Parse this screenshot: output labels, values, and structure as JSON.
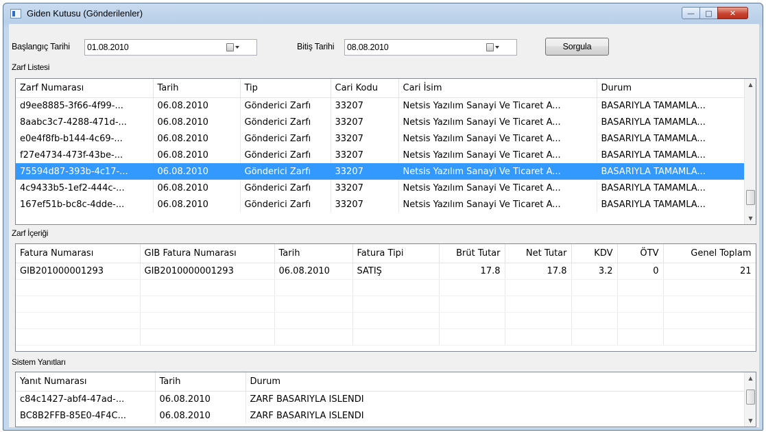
{
  "window": {
    "title": "Giden Kutusu (Gönderilenler)",
    "minimize_glyph": "—",
    "maximize_glyph": "□",
    "close_glyph": "✕"
  },
  "filters": {
    "start_label": "Başlangıç Tarihi",
    "start_value": "01.08.2010",
    "end_label": "Bitiş Tarihi",
    "end_value": "08.08.2010",
    "query_button": "Sorgula"
  },
  "envelopes": {
    "group_label": "Zarf Listesi",
    "columns": [
      "Zarf Numarası",
      "Tarih",
      "Tip",
      "Cari Kodu",
      "Cari İsim",
      "Durum"
    ],
    "rows": [
      [
        "d9ee8885-3f66-4f99-...",
        "06.08.2010",
        "Gönderici Zarfı",
        "33207",
        "Netsis Yazılım Sanayi Ve Ticaret A...",
        "BASARIYLA TAMAMLA..."
      ],
      [
        "8aabc3c7-4288-471d-...",
        "06.08.2010",
        "Gönderici Zarfı",
        "33207",
        "Netsis Yazılım Sanayi Ve Ticaret A...",
        "BASARIYLA TAMAMLA..."
      ],
      [
        "e0e4f8fb-b144-4c69-...",
        "06.08.2010",
        "Gönderici Zarfı",
        "33207",
        "Netsis Yazılım Sanayi Ve Ticaret A...",
        "BASARIYLA TAMAMLA..."
      ],
      [
        "f27e4734-473f-43be-...",
        "06.08.2010",
        "Gönderici Zarfı",
        "33207",
        "Netsis Yazılım Sanayi Ve Ticaret A...",
        "BASARIYLA TAMAMLA..."
      ],
      [
        "75594d87-393b-4c17-...",
        "06.08.2010",
        "Gönderici Zarfı",
        "33207",
        "Netsis Yazılım Sanayi Ve Ticaret A...",
        "BASARIYLA TAMAMLA..."
      ],
      [
        "4c9433b5-1ef2-444c-...",
        "06.08.2010",
        "Gönderici Zarfı",
        "33207",
        "Netsis Yazılım Sanayi Ve Ticaret A...",
        "BASARIYLA TAMAMLA..."
      ],
      [
        "167ef51b-bc8c-4dde-...",
        "06.08.2010",
        "Gönderici Zarfı",
        "33207",
        "Netsis Yazılım Sanayi Ve Ticaret A...",
        "BASARIYLA TAMAMLA..."
      ]
    ],
    "selected_row": 4,
    "accent_color": "#3399ff"
  },
  "contents": {
    "group_label": "Zarf İçeriği",
    "columns": [
      "Fatura Numarası",
      "GIB Fatura Numarası",
      "Tarih",
      "Fatura Tipi",
      "Brüt Tutar",
      "Net Tutar",
      "KDV",
      "ÖTV",
      "Genel Toplam"
    ],
    "rows": [
      [
        "GIB201000001293",
        "GIB2010000001293",
        "06.08.2010",
        "SATIŞ",
        "17.8",
        "17.8",
        "3.2",
        "0",
        "21"
      ]
    ]
  },
  "responses": {
    "group_label": "Sistem Yanıtları",
    "columns": [
      "Yanıt Numarası",
      "Tarih",
      "Durum"
    ],
    "rows": [
      [
        "c84c1427-abf4-47ad-...",
        "06.08.2010",
        "ZARF BASARIYLA ISLENDI"
      ],
      [
        "BC8B2FFB-85E0-4F4C...",
        "06.08.2010",
        "ZARF BASARIYLA ISLENDI"
      ]
    ]
  },
  "icons": {
    "scroll_up": "▲",
    "scroll_down": "▼"
  }
}
